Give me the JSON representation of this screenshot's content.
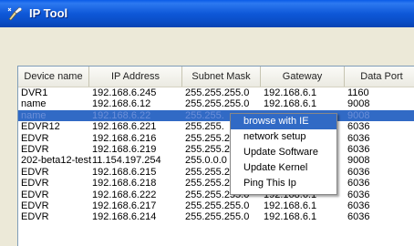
{
  "window": {
    "title": "IP Tool"
  },
  "table": {
    "columns": [
      "Device name",
      "IP Address",
      "Subnet Mask",
      "Gateway",
      "Data Port"
    ],
    "rows": [
      [
        "DVR1",
        "192.168.6.245",
        "255.255.255.0",
        "192.168.6.1",
        "1160"
      ],
      [
        "name",
        "192.168.6.12",
        "255.255.255.0",
        "192.168.6.1",
        "9008"
      ],
      [
        "name",
        "192.168.6.22",
        "255.255.",
        "",
        "9008"
      ],
      [
        "EDVR12",
        "192.168.6.221",
        "255.255.",
        "",
        "6036"
      ],
      [
        "EDVR",
        "192.168.6.216",
        "255.255.2",
        "",
        "6036"
      ],
      [
        "EDVR",
        "192.168.6.219",
        "255.255.2",
        "",
        "6036"
      ],
      [
        "202-beta12-test",
        "11.154.197.254",
        "255.0.0.0",
        "",
        "9008"
      ],
      [
        "EDVR",
        "192.168.6.215",
        "255.255.2",
        "",
        "6036"
      ],
      [
        "EDVR",
        "192.168.6.218",
        "255.255.2",
        "",
        "6036"
      ],
      [
        "EDVR",
        "192.168.6.222",
        "255.255.255.0",
        "192.168.6.1",
        "6036"
      ],
      [
        "EDVR",
        "192.168.6.217",
        "255.255.255.0",
        "192.168.6.1",
        "6036"
      ],
      [
        "EDVR",
        "192.168.6.214",
        "255.255.255.0",
        "192.168.6.1",
        "6036"
      ]
    ],
    "selected_row": 2
  },
  "context_menu": {
    "items": [
      "browse with IE",
      "network setup",
      "Update Software",
      "Update Kernel",
      "Ping This Ip"
    ],
    "highlighted": 0
  }
}
